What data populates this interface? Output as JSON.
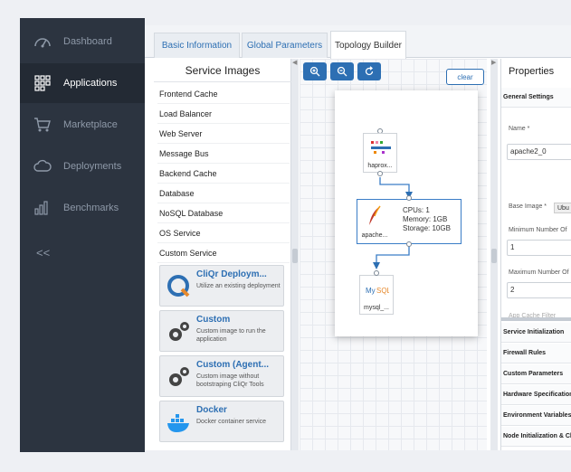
{
  "sidebar": {
    "items": [
      {
        "label": "Dashboard",
        "icon": "dashboard-icon",
        "active": false
      },
      {
        "label": "Applications",
        "icon": "applications-icon",
        "active": true
      },
      {
        "label": "Marketplace",
        "icon": "cart-icon",
        "active": false
      },
      {
        "label": "Deployments",
        "icon": "cloud-icon",
        "active": false
      },
      {
        "label": "Benchmarks",
        "icon": "chart-icon",
        "active": false
      }
    ],
    "collapse_label": "<<"
  },
  "tabs": [
    {
      "label": "Basic Information",
      "active": false
    },
    {
      "label": "Global Parameters",
      "active": false
    },
    {
      "label": "Topology Builder",
      "active": true
    }
  ],
  "service_images": {
    "title": "Service Images",
    "categories": [
      "Frontend Cache",
      "Load Balancer",
      "Web Server",
      "Message Bus",
      "Backend Cache",
      "Database",
      "NoSQL Database",
      "OS Service",
      "Custom Service"
    ],
    "cards": [
      {
        "title": "CliQr Deploym...",
        "desc": "Utilize an existing deployment",
        "icon": "cliqr-icon"
      },
      {
        "title": "Custom",
        "desc": "Custom image to run the application",
        "icon": "gears-icon"
      },
      {
        "title": "Custom (Agent...",
        "desc": "Custom image without bootstraping CliQr Tools",
        "icon": "gears-icon"
      },
      {
        "title": "Docker",
        "desc": "Docker container service",
        "icon": "docker-icon"
      }
    ]
  },
  "toolbar": {
    "clear_label": "clear"
  },
  "canvas": {
    "nodes": [
      {
        "label": "haprox..."
      },
      {
        "label": "apache..."
      },
      {
        "label": "mysql_..."
      }
    ],
    "selected_info": {
      "cpus": "CPUs: 1",
      "memory": "Memory: 1GB",
      "storage": "Storage: 10GB"
    }
  },
  "properties": {
    "title": "Properties",
    "general_settings": "General Settings",
    "name_label": "Name *",
    "name_value": "apache2_0",
    "base_image_label": "Base Image *",
    "base_image_value": "Ubu",
    "min_label": "Minimum Number Of",
    "min_value": "1",
    "max_label": "Maximum Number Of",
    "max_value": "2",
    "cut_label": "App Cache Filter",
    "sections": [
      "Service Initialization",
      "Firewall Rules",
      "Custom Parameters",
      "Hardware Specification",
      "Environment Variables",
      "Node Initialization & Cl"
    ]
  },
  "colors": {
    "accent": "#2d6fb3",
    "sidebar": "#2c3440"
  }
}
